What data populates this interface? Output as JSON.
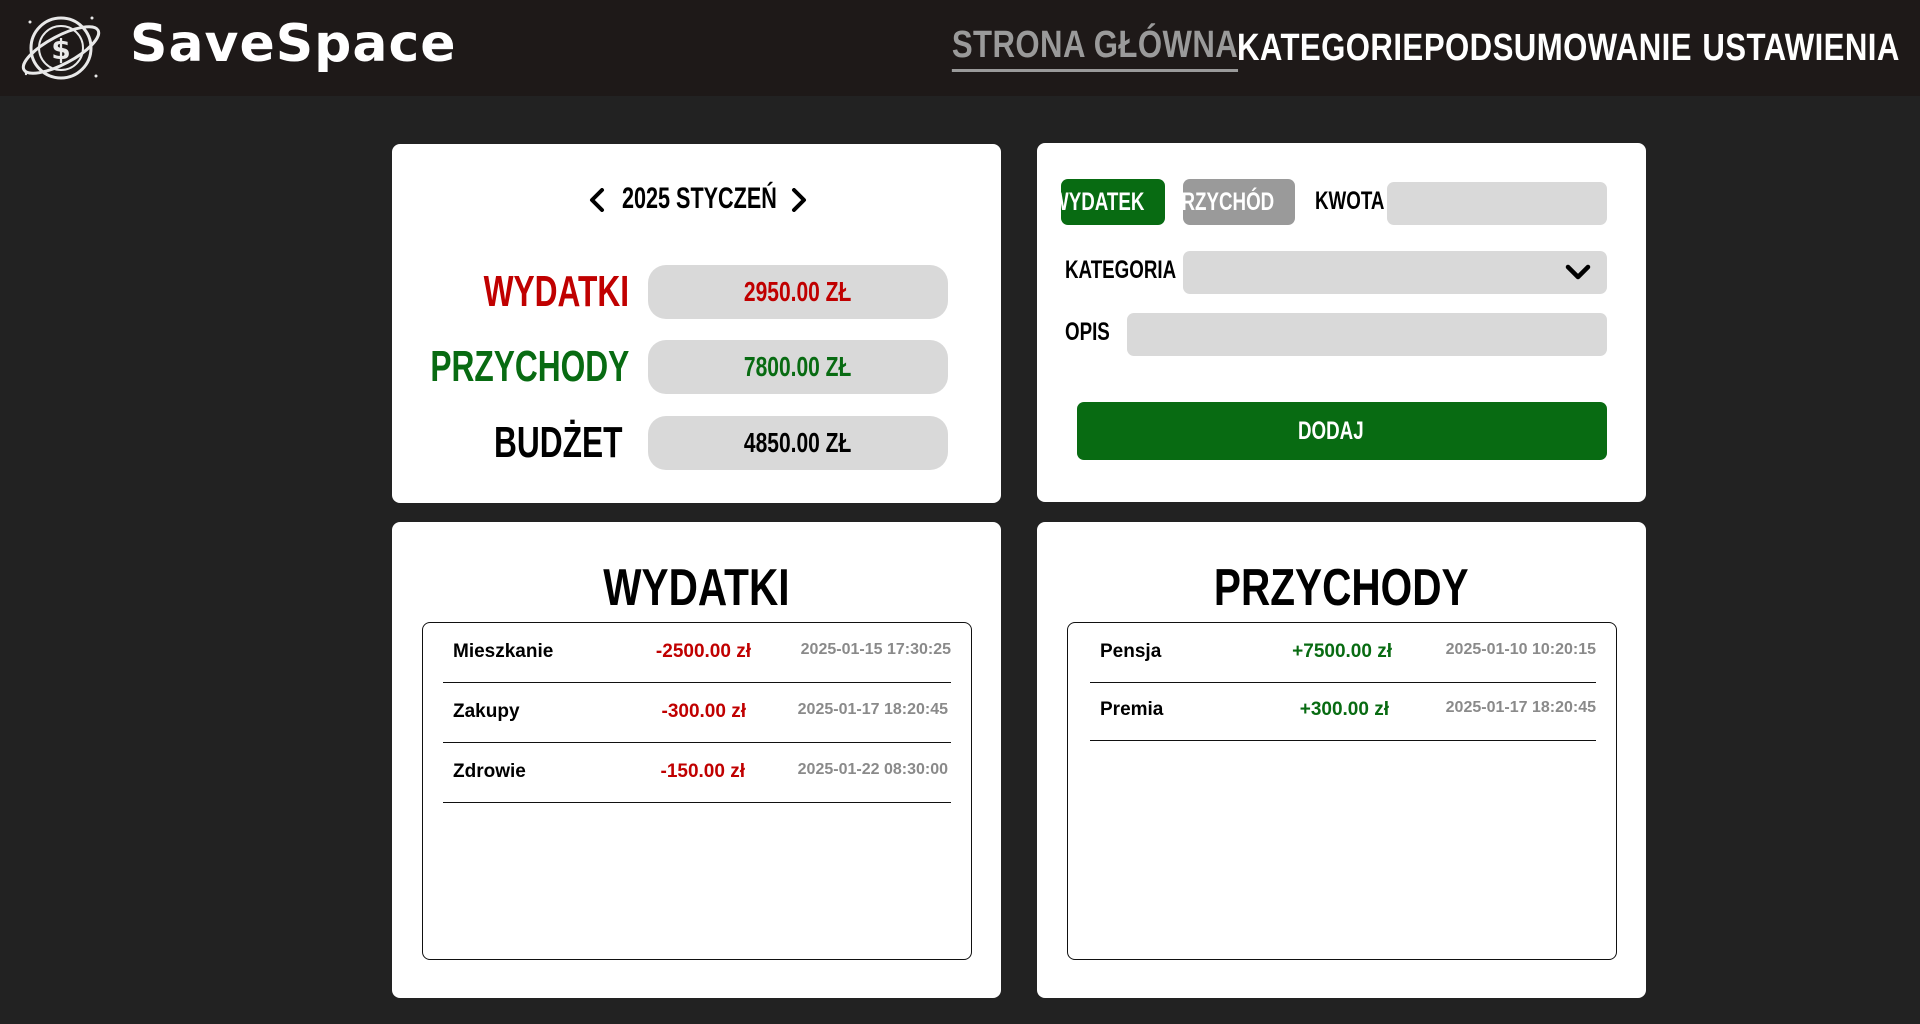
{
  "header": {
    "brand": "SaveSpace",
    "nav": [
      {
        "label": "STRONA GŁÓWNA",
        "active": true
      },
      {
        "label": "KATEGORIE",
        "active": false
      },
      {
        "label": "PODSUMOWANIE",
        "active": false
      },
      {
        "label": "USTAWIENIA",
        "active": false
      }
    ]
  },
  "summary": {
    "month_label": "2025 STYCZEŃ",
    "rows": [
      {
        "label": "WYDATKI",
        "value": "2950.00 ZŁ",
        "color": "#c00000"
      },
      {
        "label": "PRZYCHODY",
        "value": "7800.00 ZŁ",
        "color": "#086b12"
      },
      {
        "label": "BUDŻET",
        "value": "4850.00 ZŁ",
        "color": "#000000"
      }
    ]
  },
  "form": {
    "expense_label": "WYDATEK",
    "income_label": "PRZYCHÓD",
    "amount_label": "KWOTA",
    "amount_value": "",
    "category_label": "KATEGORIA",
    "category_value": "",
    "description_label": "OPIS",
    "description_value": "",
    "add_label": "DODAJ"
  },
  "expenses": {
    "title": "WYDATKI",
    "items": [
      {
        "name": "Mieszkanie",
        "amount": "-2500.00 zł",
        "date": "2025-01-15 17:30:25"
      },
      {
        "name": "Zakupy",
        "amount": "-300.00 zł",
        "date": "2025-01-17 18:20:45"
      },
      {
        "name": "Zdrowie",
        "amount": "-150.00 zł",
        "date": "2025-01-22 08:30:00"
      }
    ]
  },
  "incomes": {
    "title": "PRZYCHODY",
    "items": [
      {
        "name": "Pensja",
        "amount": "+7500.00 zł",
        "date": "2025-01-10 10:20:15"
      },
      {
        "name": "Premia",
        "amount": "+300.00 zł",
        "date": "2025-01-17 18:20:45"
      }
    ]
  },
  "colors": {
    "expense": "#c00000",
    "income": "#086b12",
    "accent": "#086b12",
    "inactive": "#9a9a9a"
  },
  "icons": {
    "logo": "planet-coin-logo",
    "prev": "chevron-left-icon",
    "next": "chevron-right-icon",
    "dropdown": "chevron-down-icon"
  }
}
